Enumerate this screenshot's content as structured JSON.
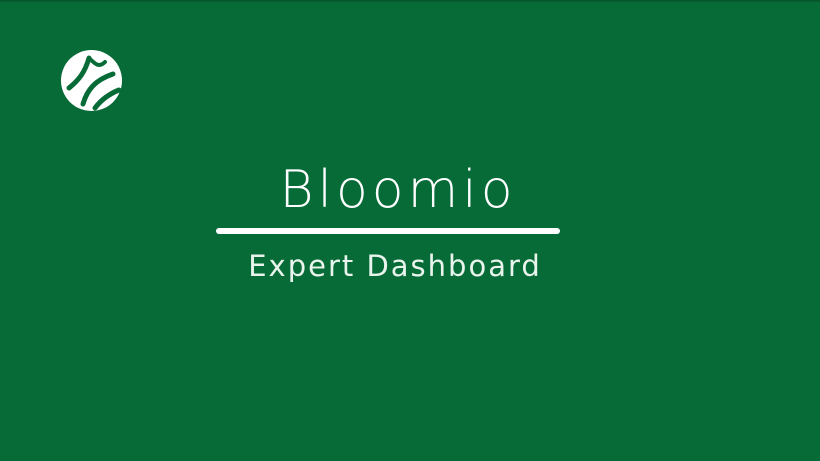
{
  "colors": {
    "background": "#076b38",
    "foreground": "#ffffff"
  },
  "logo": {
    "icon": "leaf-logo-icon"
  },
  "splash": {
    "title": "Bloomio",
    "subtitle": "Expert Dashboard"
  }
}
